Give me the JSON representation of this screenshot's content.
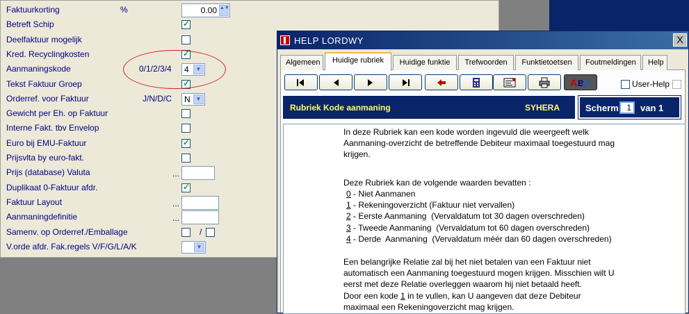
{
  "form": {
    "rows": [
      {
        "label": "Faktuurkorting",
        "code": "%",
        "field": "number",
        "value": "0.00"
      },
      {
        "label": "Betreft Schip",
        "field": "check",
        "checked": true
      },
      {
        "label": "Deelfaktuur mogelijk",
        "field": "check",
        "checked": false
      },
      {
        "label": "Kred. Recyclingkosten",
        "field": "check",
        "checked": true
      },
      {
        "label": "Aanmaningskode",
        "code": "0/1/2/3/4",
        "field": "select",
        "value": "4"
      },
      {
        "label": "Tekst Faktuur Groep",
        "field": "check",
        "checked": true
      },
      {
        "label": "Orderref. voor Faktuur",
        "code": "J/N/D/C",
        "field": "select",
        "value": "N"
      },
      {
        "label": "Gewicht per Eh. op Faktuur",
        "field": "check",
        "checked": false
      },
      {
        "label": "Interne Fakt. tbv Envelop",
        "field": "check",
        "checked": false
      },
      {
        "label": "Euro bij EMU-Faktuur",
        "field": "check",
        "checked": true
      },
      {
        "label": "Prijsvlta by euro-fakt.",
        "field": "check",
        "checked": false
      },
      {
        "label": "Prijs (database) Valuta",
        "dots": "...",
        "field": "text",
        "value": ""
      },
      {
        "label": "Duplikaat 0-Faktuur afdr.",
        "field": "check",
        "checked": true
      },
      {
        "label": "Faktuur Layout",
        "dots": "...",
        "field": "text",
        "value": ""
      },
      {
        "label": "Aanmaningdefinitie",
        "dots": "...",
        "field": "text",
        "value": ""
      },
      {
        "label": "Samenv. op Orderref./Emballage",
        "field": "check2",
        "checked": false,
        "sep": "/"
      },
      {
        "label": "V.orde afdr. Fak.regels V/F/G/L/A/K",
        "field": "select",
        "value": ""
      }
    ]
  },
  "help": {
    "title": "HELP LORDWY",
    "close_label": "X",
    "tabs": [
      "Algemeen",
      "Huidige rubriek",
      "Huidige funktie",
      "Trefwoorden",
      "Funktietoetsen",
      "Foutmeldingen",
      "Help"
    ],
    "active_tab": 1,
    "nav_buttons": [
      "first-icon",
      "previous-icon",
      "next-icon",
      "last-icon",
      "back-arrow-icon",
      "calculator-icon",
      "notepad-icon",
      "printer-icon",
      "spellcheck-icon"
    ],
    "user_help_label": "User-Help",
    "rubriek_title": "Rubriek Kode aanmaning",
    "rubriek_code": "SYHERA",
    "scherm_label": "Scherm",
    "scherm_value": "1",
    "scherm_of": "van 1",
    "text": {
      "p1_l1": "In deze Rubriek kan een kode worden ingevuld die weergeeft welk",
      "p1_l2": "Aanmaning-overzicht de betreffende Debiteur maximaal toegestuurd mag",
      "p1_l3": "krijgen.",
      "p2": "Deze Rubriek kan de volgende waarden bevatten :",
      "options": [
        {
          "k": "0",
          "t": " - Niet Aanmanen"
        },
        {
          "k": "1",
          "t": " - Rekeningoverzicht (Faktuur niet vervallen)"
        },
        {
          "k": "2",
          "t": " - Eerste Aanmaning  (Vervaldatum tot 30 dagen overschreden)"
        },
        {
          "k": "3",
          "t": " - Tweede Aanmaning  (Vervaldatum tot 60 dagen overschreden)"
        },
        {
          "k": "4",
          "t": " - Derde  Aanmaning  (Vervaldatum méér dan 60 dagen overschreden)"
        }
      ],
      "p3_l1": "Een belangrijke Relatie zal bij het niet betalen van een Faktuur niet",
      "p3_l2": "automatisch een Aanmaning toegestuurd mogen krijgen. Misschien wilt U",
      "p3_l3": "eerst met deze Relatie overleggen waarom hij niet betaald heeft.",
      "p4_l1a": "Door een kode ",
      "p4_l1k": "1",
      "p4_l1b": " in te vullen, kan U aangeven dat deze Debiteur",
      "p4_l2": "maximaal een Rekeningoverzicht mag krijgen."
    }
  }
}
